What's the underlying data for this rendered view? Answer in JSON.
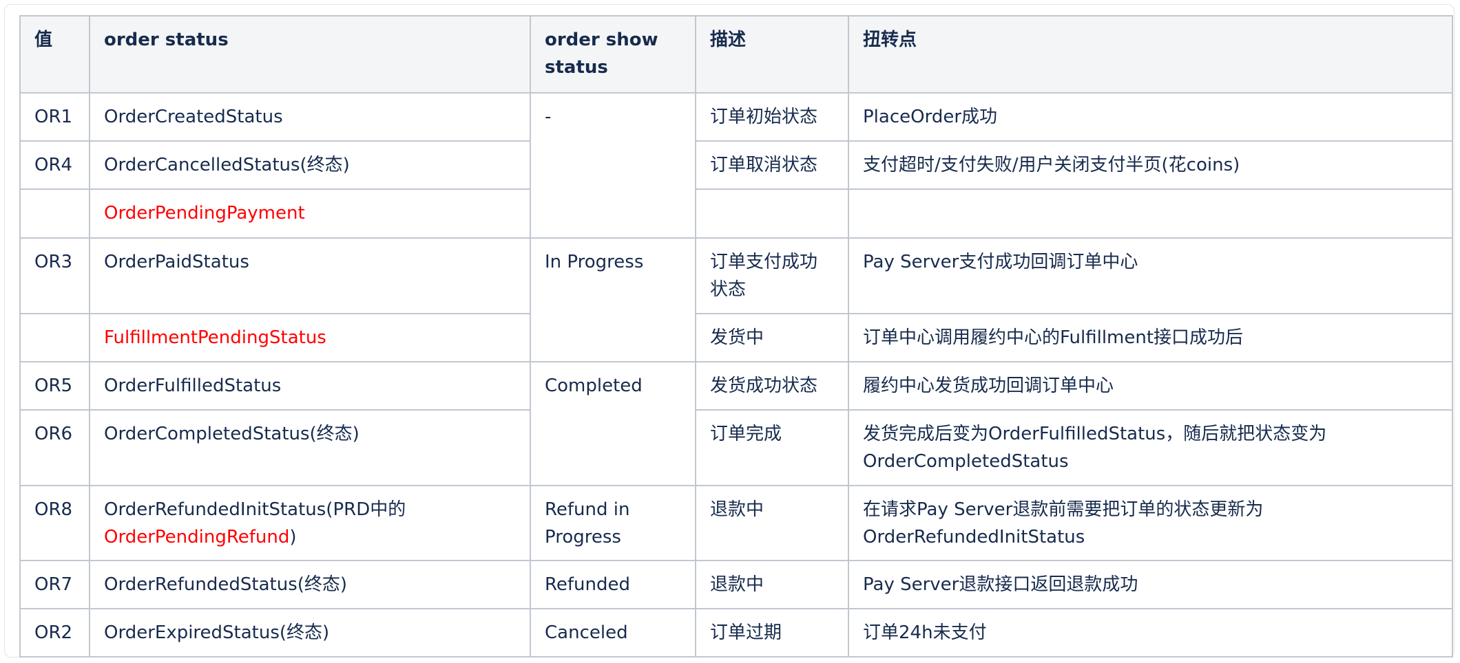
{
  "table": {
    "headers": [
      "值",
      "order status",
      "order show status",
      "描述",
      "扭转点"
    ],
    "rows": [
      {
        "code": "OR1",
        "status": "OrderCreatedStatus",
        "desc": "订单初始状态",
        "turn": "PlaceOrder成功"
      },
      {
        "code": "OR4",
        "status": "OrderCancelledStatus(终态)",
        "desc": "订单取消状态",
        "turn": "支付超时/支付失败/用户关闭支付半页(花coins)"
      },
      {
        "code": "",
        "status": "OrderPendingPayment",
        "desc": "",
        "turn": ""
      },
      {
        "code": "OR3",
        "status": "OrderPaidStatus",
        "desc": "订单支付成功状态",
        "turn": "Pay Server支付成功回调订单中心"
      },
      {
        "code": "",
        "status": "FulfillmentPendingStatus",
        "desc": "发货中",
        "turn": "订单中心调用履约中心的Fulfillment接口成功后"
      },
      {
        "code": "OR5",
        "status": "OrderFulfilledStatus",
        "desc": "发货成功状态",
        "turn": "履约中心发货成功回调订单中心"
      },
      {
        "code": "OR6",
        "status": "OrderCompletedStatus(终态)",
        "desc": "订单完成",
        "turn": "发货完成后变为OrderFulfilledStatus，随后就把状态变为OrderCompletedStatus"
      },
      {
        "code": "OR8",
        "status_part1": "OrderRefundedInitStatus(PRD中的",
        "status_part2": "OrderPendingRefund",
        "status_part3": ")",
        "desc": "退款中",
        "turn": "在请求Pay Server退款前需要把订单的状态更新为OrderRefundedInitStatus"
      },
      {
        "code": "OR7",
        "status": "OrderRefundedStatus(终态)",
        "desc": "退款中",
        "turn": "Pay Server退款接口返回退款成功"
      },
      {
        "code": "OR2",
        "status": "OrderExpiredStatus(终态)",
        "desc": "订单过期",
        "turn": "订单24h未支付"
      }
    ],
    "show_status": {
      "group1": "-",
      "group2": "In Progress",
      "group3": "Completed",
      "group4": "Refund in Progress",
      "group5": "Refunded",
      "group6": "Canceled"
    }
  },
  "colors": {
    "highlight": "#ff0000",
    "header_bg": "#f4f5f7",
    "border": "#c1c7d0",
    "text": "#172b4d"
  }
}
